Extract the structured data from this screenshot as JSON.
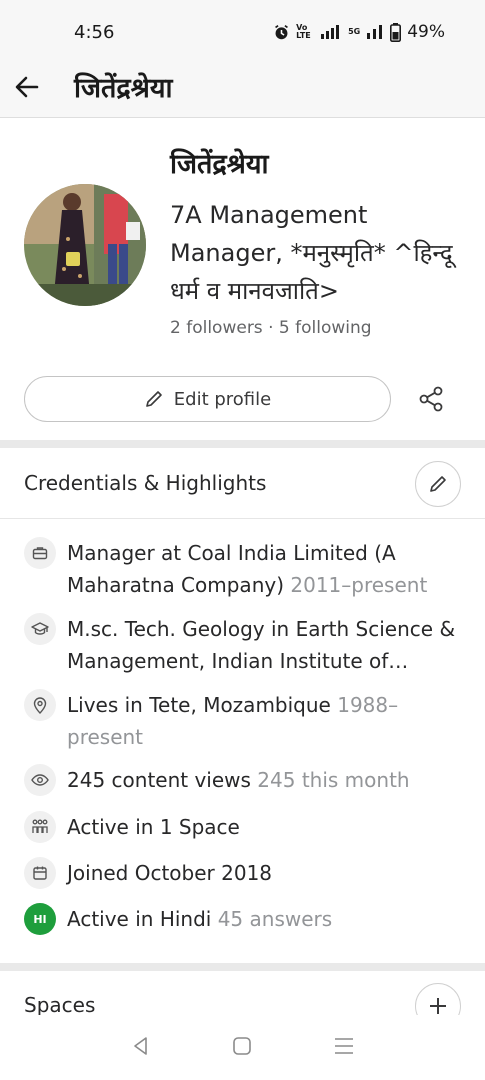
{
  "status": {
    "time": "4:56",
    "network": "Vo LTE",
    "signal_5g": "5G",
    "battery": "49%"
  },
  "appbar": {
    "title": "जितेंद्रश्रेया"
  },
  "profile": {
    "name": "जितेंद्रश्रेया",
    "bio_line1": "7A Management",
    "bio_line2": "Manager, *मनुस्मृति* ^हिन्दू",
    "bio_line3": "धर्म व मानवजाति>",
    "followers": "2 followers",
    "separator": "·",
    "following": "5 following"
  },
  "actions": {
    "edit_label": "Edit profile"
  },
  "credentials": {
    "header": "Credentials & Highlights",
    "items": [
      {
        "icon": "briefcase-icon",
        "text": "Manager at Coal India Limited (A Maharatna Company)",
        "muted": " 2011–present"
      },
      {
        "icon": "graduation-cap-icon",
        "text": "M.sc. Tech. Geology in Earth Science & Management, Indian Institute of…",
        "muted": ""
      },
      {
        "icon": "location-pin-icon",
        "text": "Lives in Tete, Mozambique",
        "muted": " 1988–present"
      },
      {
        "icon": "eye-icon",
        "text": "245 content views",
        "muted": " 245 this month"
      },
      {
        "icon": "people-icon",
        "text": "Active in 1 Space",
        "muted": ""
      },
      {
        "icon": "calendar-icon",
        "text": "Joined October 2018",
        "muted": ""
      },
      {
        "icon": "language-badge-icon",
        "badge": "HI",
        "text": "Active in Hindi",
        "muted": " 45 answers"
      }
    ]
  },
  "spaces": {
    "header": "Spaces"
  },
  "colors": {
    "accent_green": "#1e9e3c",
    "muted_text": "#939598",
    "divider": "#e9e9e9"
  }
}
